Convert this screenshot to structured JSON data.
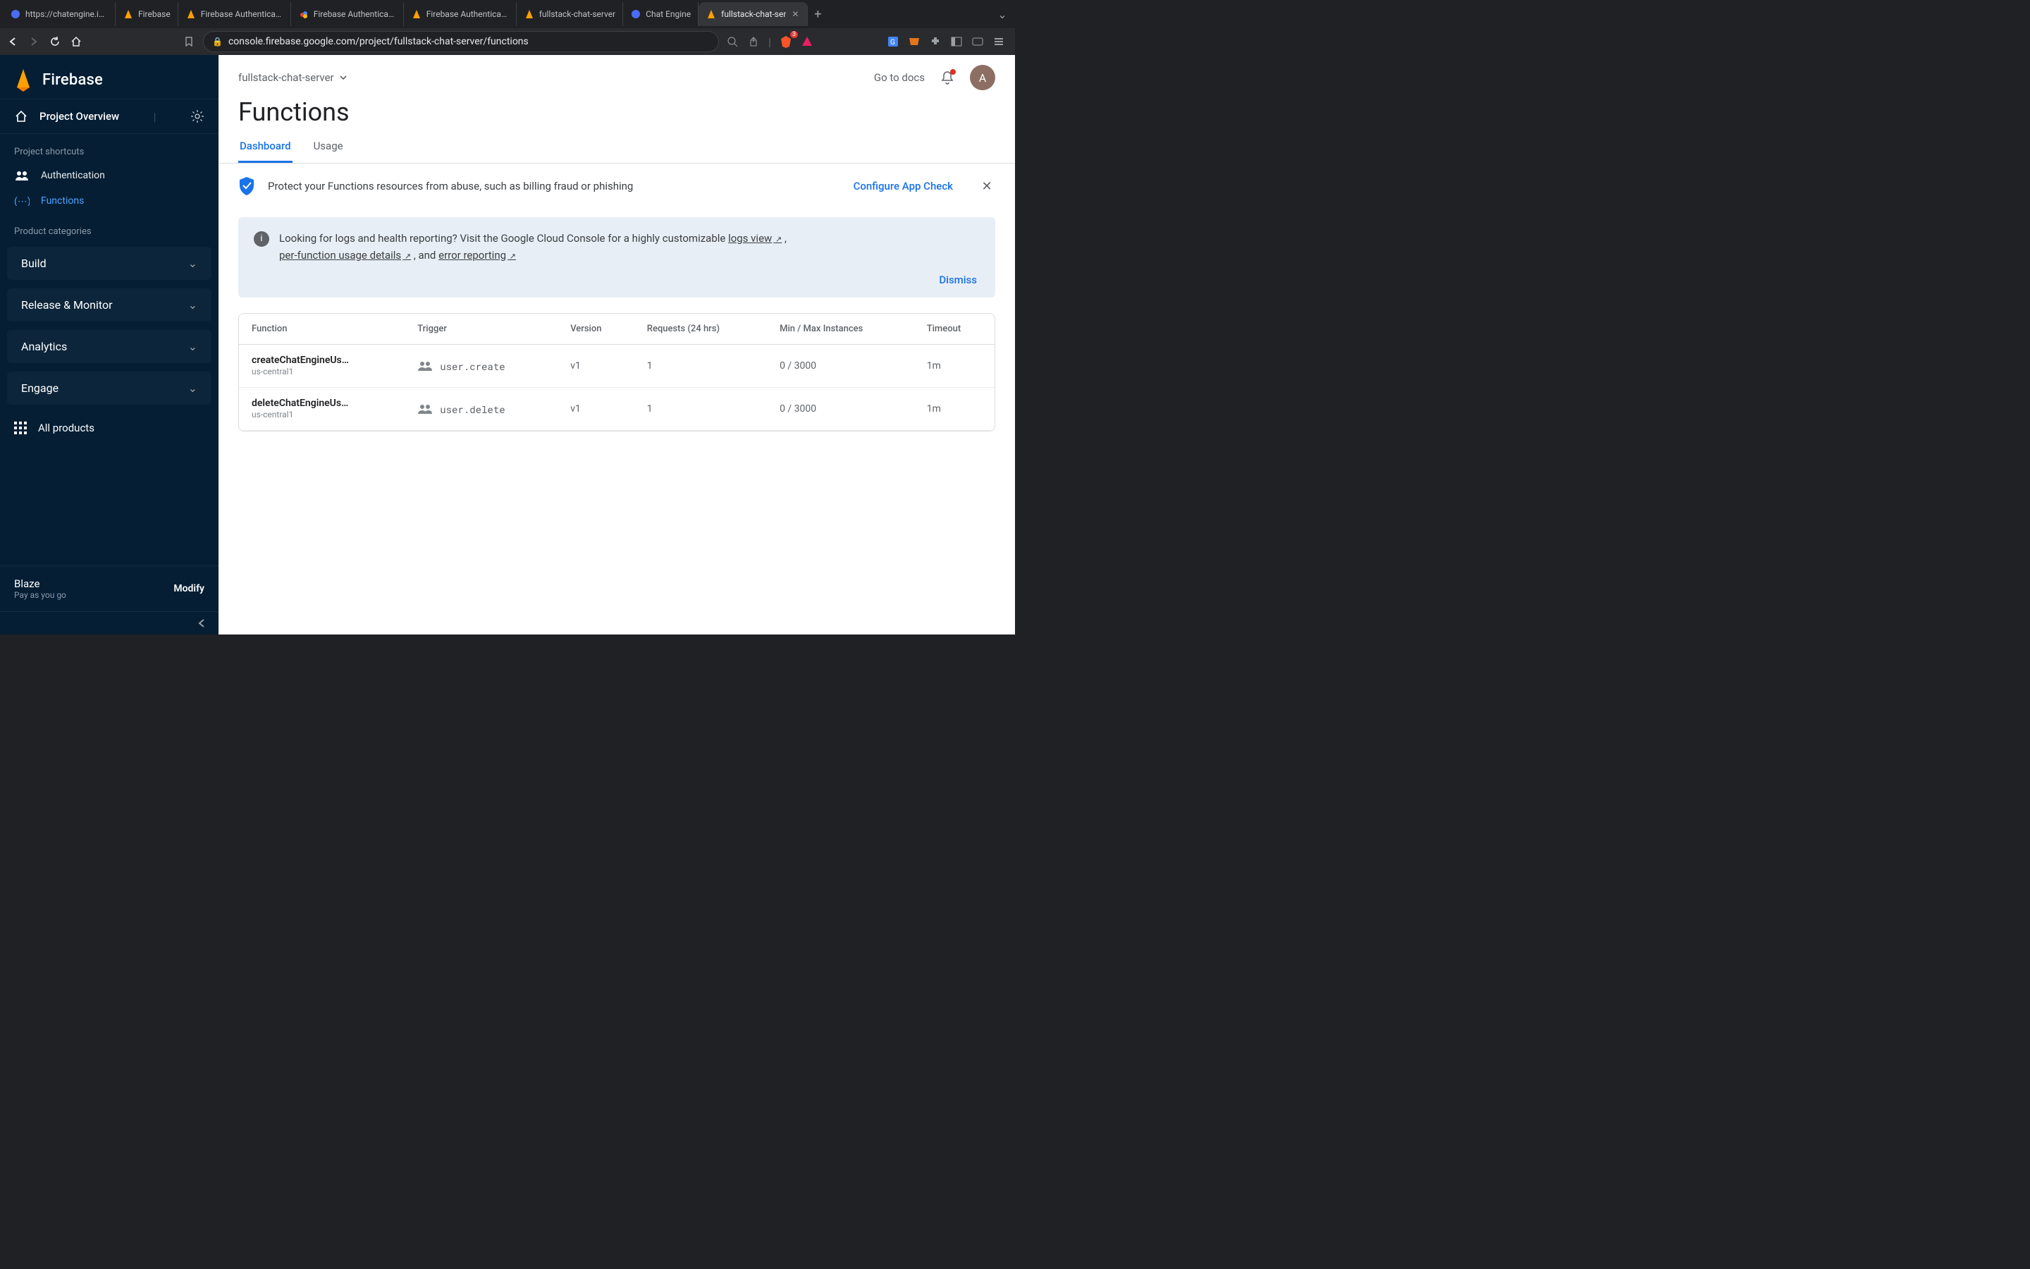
{
  "browser": {
    "tabs": [
      {
        "title": "https://chatengine.io/p",
        "favicon": "chatengine"
      },
      {
        "title": "Firebase",
        "favicon": "firebase"
      },
      {
        "title": "Firebase Authenticatio",
        "favicon": "firebase"
      },
      {
        "title": "Firebase Authenticatio",
        "favicon": "gcloud"
      },
      {
        "title": "Firebase Authenticatio",
        "favicon": "firebase"
      },
      {
        "title": "fullstack-chat-server",
        "favicon": "firebase"
      },
      {
        "title": "Chat Engine",
        "favicon": "chatengine"
      },
      {
        "title": "fullstack-chat-ser",
        "favicon": "firebase",
        "active": true
      }
    ],
    "url": "console.firebase.google.com/project/fullstack-chat-server/functions",
    "brave_count": "3"
  },
  "sidebar": {
    "brand": "Firebase",
    "overview": "Project Overview",
    "shortcuts_label": "Project shortcuts",
    "shortcuts": [
      {
        "label": "Authentication",
        "active": false
      },
      {
        "label": "Functions",
        "active": true
      }
    ],
    "categories_label": "Product categories",
    "categories": [
      {
        "label": "Build"
      },
      {
        "label": "Release & Monitor"
      },
      {
        "label": "Analytics"
      },
      {
        "label": "Engage"
      }
    ],
    "all_products": "All products",
    "plan_name": "Blaze",
    "plan_sub": "Pay as you go",
    "modify": "Modify"
  },
  "header": {
    "project": "fullstack-chat-server",
    "docs": "Go to docs",
    "avatar": "A"
  },
  "page": {
    "title": "Functions",
    "tabs": {
      "dashboard": "Dashboard",
      "usage": "Usage"
    },
    "banner": {
      "text": "Protect your Functions resources from abuse, such as billing fraud or phishing",
      "cta": "Configure App Check"
    },
    "info": {
      "p1": "Looking for logs and health reporting? Visit the Google Cloud Console for a highly customizable ",
      "l1": "logs view",
      "p2": " , ",
      "l2": "per-function usage details",
      "p3": " , and ",
      "l3": "error reporting",
      "dismiss": "Dismiss"
    }
  },
  "table": {
    "headers": {
      "fn": "Function",
      "trigger": "Trigger",
      "version": "Version",
      "requests": "Requests (24 hrs)",
      "instances": "Min / Max Instances",
      "timeout": "Timeout"
    },
    "rows": [
      {
        "name": "createChatEngineUs…",
        "region": "us-central1",
        "trigger": "user.create",
        "version": "v1",
        "requests": "1",
        "instances": "0 / 3000",
        "timeout": "1m"
      },
      {
        "name": "deleteChatEngineUs…",
        "region": "us-central1",
        "trigger": "user.delete",
        "version": "v1",
        "requests": "1",
        "instances": "0 / 3000",
        "timeout": "1m"
      }
    ]
  }
}
